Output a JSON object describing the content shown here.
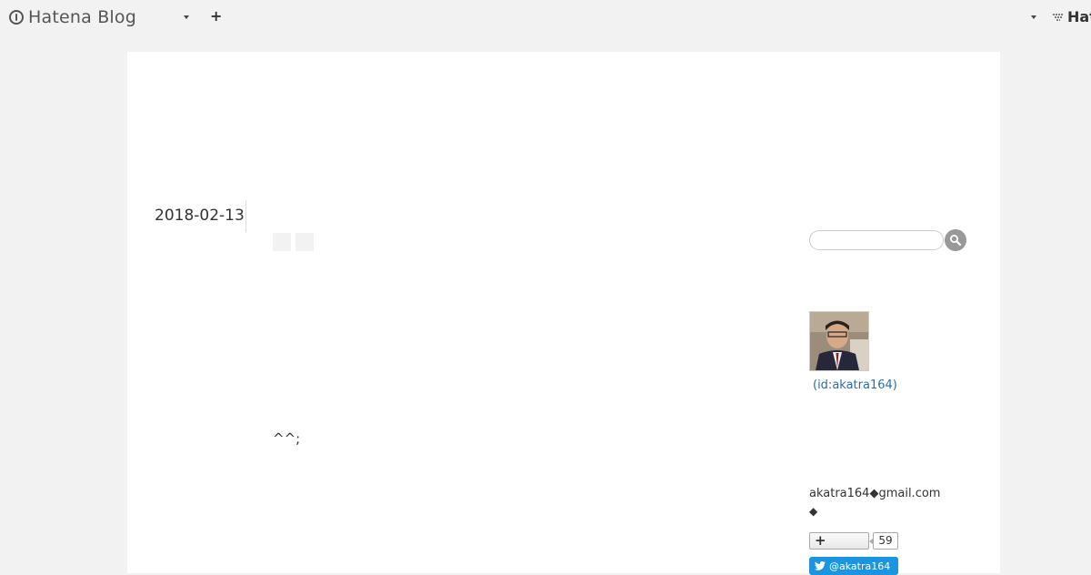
{
  "topbar": {
    "brand": "Hatena Blog",
    "add_label": "+",
    "right_brand": "Hat"
  },
  "entry": {
    "date": "2018-02-13",
    "body_text": "^^;"
  },
  "sidebar": {
    "search": {
      "placeholder": "",
      "value": ""
    },
    "profile": {
      "id_text": "(id:akatra164)",
      "email": "akatra164◆gmail.com",
      "email_note": "◆"
    },
    "subscribe": {
      "count": "59"
    },
    "twitter": {
      "handle": "@akatra164"
    }
  },
  "colors": {
    "page_bg": "#f2f2f2",
    "panel_bg": "#ffffff",
    "link": "#2d6ea3",
    "twitter": "#1b95e0"
  },
  "icons": {
    "logo": "hatena-blog-logo-icon",
    "search": "search-icon",
    "twitter": "twitter-bird-icon"
  }
}
